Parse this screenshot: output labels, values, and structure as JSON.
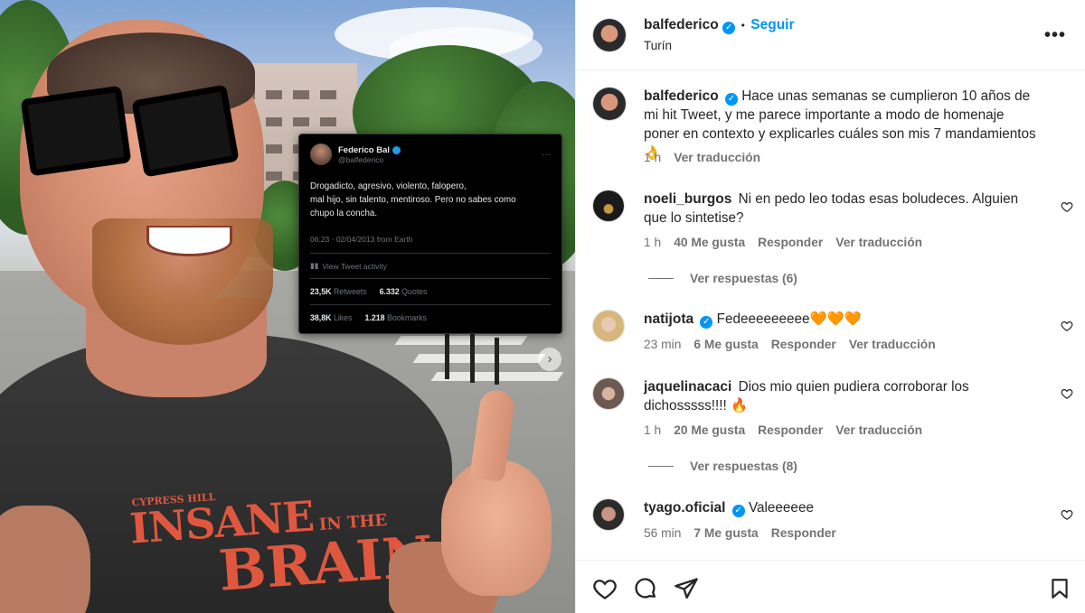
{
  "tweet": {
    "name": "Federico Bal",
    "handle": "@balfederico",
    "body_lines": [
      "Drogadicto, agresivo, violento, falopero,",
      "mal hijo, sin talento, mentiroso. Pero no sabes como",
      "chupo la concha."
    ],
    "timestamp": "06:23 · 02/04/2013 from Earth",
    "activity": "View Tweet activity",
    "retweets_num": "23,5K",
    "retweets_lbl": "Retweets",
    "quotes_num": "6.332",
    "quotes_lbl": "Quotes",
    "likes_num": "38,8K",
    "likes_lbl": "Likes",
    "bookmarks_num": "1.218",
    "bookmarks_lbl": "Bookmarks"
  },
  "shirt_text": {
    "line1": "INSANE",
    "line1b": "IN THE",
    "line2": "BRAIN",
    "small": "CYPRESS HILL"
  },
  "header": {
    "username": "balfederico",
    "separator": "•",
    "follow": "Seguir",
    "location": "Turín"
  },
  "caption": {
    "username": "balfederico",
    "text": "Hace unas semanas se cumplieron 10 años de mi hit Tweet, y me parece importante a modo de homenaje poner en contexto y explicarles cuáles son mis 7 mandamientos 👌",
    "time": "1 h",
    "translate": "Ver traducción"
  },
  "comments": [
    {
      "username": "noeli_burgos",
      "verified": false,
      "text": "Ni en pedo leo todas esas boludeces. Alguien que lo sintetise?",
      "time": "1 h",
      "likes": "40 Me gusta",
      "reply": "Responder",
      "translate": "Ver traducción",
      "view_replies": "Ver respuestas (6)"
    },
    {
      "username": "natijota",
      "verified": true,
      "text": "Fedeeeeeeeee🧡🧡🧡",
      "time": "23 min",
      "likes": "6 Me gusta",
      "reply": "Responder",
      "translate": "Ver traducción"
    },
    {
      "username": "jaquelinacaci",
      "verified": false,
      "text": "Dios mio quien pudiera corroborar los dichosssss!!!! 🔥",
      "time": "1 h",
      "likes": "20 Me gusta",
      "reply": "Responder",
      "translate": "Ver traducción",
      "view_replies": "Ver respuestas (8)"
    },
    {
      "username": "tyago.oficial",
      "verified": true,
      "text": "Valeeeeee",
      "time": "56 min",
      "likes": "7 Me gusta",
      "reply": "Responder"
    }
  ],
  "icons": {
    "like": "heart-icon",
    "comment": "comment-icon",
    "share": "share-icon",
    "save": "bookmark-icon",
    "more": "more-options-icon"
  },
  "colors": {
    "accent": "#0095f6",
    "text": "#262626",
    "muted": "#737373",
    "border": "#efefef"
  }
}
